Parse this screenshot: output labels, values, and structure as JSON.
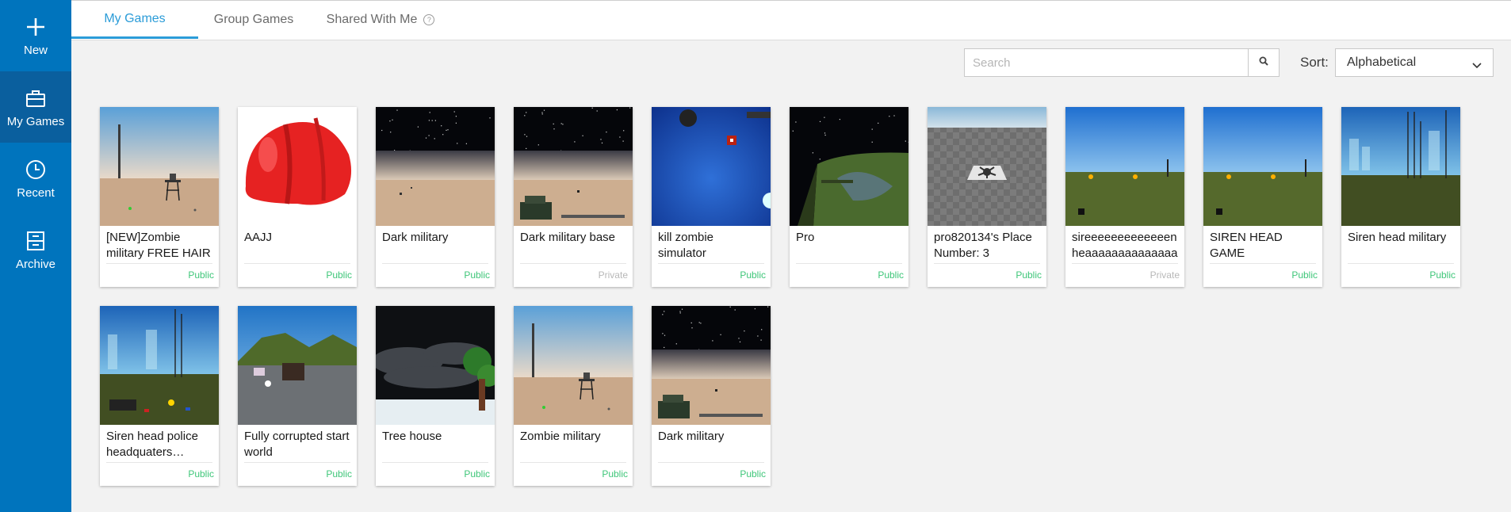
{
  "sidebar": {
    "items": [
      {
        "label": "New",
        "icon": "plus-icon"
      },
      {
        "label": "My Games",
        "icon": "briefcase-icon"
      },
      {
        "label": "Recent",
        "icon": "clock-icon"
      },
      {
        "label": "Archive",
        "icon": "archive-box-icon"
      }
    ],
    "active": "My Games"
  },
  "tabs": [
    {
      "label": "My Games",
      "active": true
    },
    {
      "label": "Group Games",
      "active": false
    },
    {
      "label": "Shared With Me",
      "active": false,
      "icon": "help-icon"
    }
  ],
  "help_icon": "?",
  "search": {
    "placeholder": "Search",
    "value": ""
  },
  "sort": {
    "label": "Sort:",
    "selected": "Alphabetical"
  },
  "colors": {
    "sidebar": "#0074bd",
    "sidebar_active": "#0a5f9e",
    "tab_active": "#2b9cd8",
    "public": "#3fc679",
    "private": "#b8b8b8"
  },
  "games": [
    {
      "title": "[NEW]Zombie military FREE HAIR",
      "status": "Public",
      "thumb": "desert-tower"
    },
    {
      "title": "AAJJ",
      "status": "Public",
      "thumb": "red-helmet"
    },
    {
      "title": "Dark military",
      "status": "Public",
      "thumb": "night-desert"
    },
    {
      "title": "Dark military base",
      "status": "Private",
      "thumb": "night-desert-base"
    },
    {
      "title": "kill zombie simulator",
      "status": "Public",
      "thumb": "blue-space"
    },
    {
      "title": "Pro",
      "status": "Public",
      "thumb": "dark-terrain"
    },
    {
      "title": "pro820134's Place Number: 3",
      "status": "Public",
      "thumb": "baseplate"
    },
    {
      "title": "sireeeeeeeeeeeeen heaaaaaaaaaaaaaad",
      "status": "Private",
      "thumb": "grass-field"
    },
    {
      "title": "SIREN HEAD GAME",
      "status": "Public",
      "thumb": "grass-field"
    },
    {
      "title": "Siren head military",
      "status": "Public",
      "thumb": "city-towers"
    },
    {
      "title": "Siren head police headquaters helicopter",
      "status": "Public",
      "thumb": "city-towers-police"
    },
    {
      "title": "Fully corrupted start world",
      "status": "Public",
      "thumb": "mountain-world"
    },
    {
      "title": "Tree house",
      "status": "Public",
      "thumb": "stormy-tree"
    },
    {
      "title": "Zombie military",
      "status": "Public",
      "thumb": "desert-tower"
    },
    {
      "title": "Dark military",
      "status": "Public",
      "thumb": "night-desert-base"
    }
  ]
}
